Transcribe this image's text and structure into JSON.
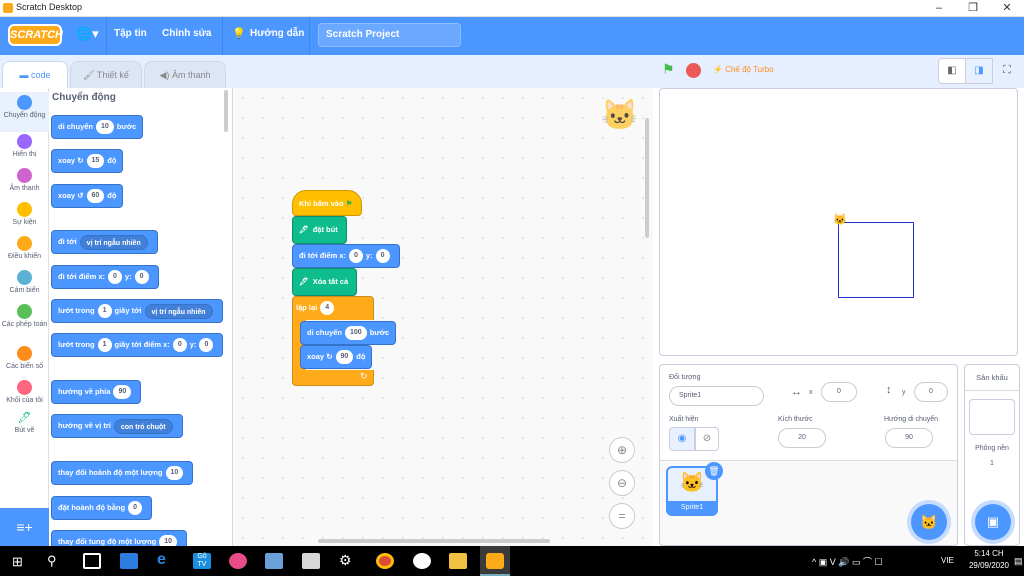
{
  "window": {
    "title": "Scratch Desktop",
    "min": "–",
    "max": "❐",
    "close": "✕"
  },
  "menubar": {
    "logo": "SCRATCH",
    "file": "Tập tin",
    "edit": "Chỉnh sửa",
    "tutorial": "Hướng dẫn",
    "project_title": "Scratch Project"
  },
  "tabs": {
    "code": "code",
    "costumes": "Thiết kế",
    "sounds": "Âm thanh"
  },
  "categories": [
    {
      "label": "Chuyển động",
      "color": "#4c97ff"
    },
    {
      "label": "Hiển thị",
      "color": "#9966ff"
    },
    {
      "label": "Âm thanh",
      "color": "#cf63cf"
    },
    {
      "label": "Sự kiện",
      "color": "#ffbf00"
    },
    {
      "label": "Điều khiển",
      "color": "#ffab19"
    },
    {
      "label": "Cảm biến",
      "color": "#5cb1d6"
    },
    {
      "label": "Các phép toán",
      "color": "#59c059"
    },
    {
      "label": "Các biến số",
      "color": "#ff8c1a"
    },
    {
      "label": "Khối của tôi",
      "color": "#ff6680"
    },
    {
      "label": "Bút vẽ",
      "color": "#0fbd8c"
    }
  ],
  "palette": {
    "heading": "Chuyển động",
    "move": {
      "a": "di chuyển",
      "v": "10",
      "b": "bước"
    },
    "turn_right": {
      "a": "xoay",
      "v": "15",
      "b": "độ"
    },
    "turn_left": {
      "a": "xoay",
      "v": "60",
      "b": "độ"
    },
    "goto": {
      "a": "đi tới",
      "dd": "vị trí ngẫu nhiên"
    },
    "goto_xy": {
      "a": "đi tới điểm x:",
      "x": "0",
      "y_label": "y:",
      "y": "0"
    },
    "glide": {
      "a": "lướt trong",
      "v": "1",
      "b": "giây tới",
      "dd": "vị trí ngẫu nhiên"
    },
    "glide_xy": {
      "a": "lướt trong",
      "v": "1",
      "b": "giây tới điểm x:",
      "x": "0",
      "y_label": "y:",
      "y": "0"
    },
    "point_dir": {
      "a": "hướng về phía",
      "v": "90"
    },
    "point_towards": {
      "a": "hướng về vị trí",
      "dd": "con trỏ chuột"
    },
    "change_x": {
      "a": "thay đổi hoành độ một lượng",
      "v": "10"
    },
    "set_x": {
      "a": "đặt hoành độ bằng",
      "v": "0"
    },
    "change_y": {
      "a": "thay đổi tung độ một lượng",
      "v": "10"
    }
  },
  "script": {
    "hat": "Khi bấm vào",
    "pen_down": "đặt bút",
    "goto": {
      "a": "đi tới điểm x:",
      "x": "0",
      "y_label": "y:",
      "y": "0"
    },
    "clear": "Xóa tất cả",
    "repeat": {
      "a": "lặp lại",
      "v": "4"
    },
    "move": {
      "a": "di chuyển",
      "v": "100",
      "b": "bước"
    },
    "turn": {
      "a": "xoay",
      "v": "90",
      "b": "độ"
    }
  },
  "stage_header": {
    "turbo": "Chế độ Turbo"
  },
  "sprite_info": {
    "sprite_label": "Đối tượng",
    "sprite_name": "Sprite1",
    "x_label": "x",
    "x": "0",
    "y_label": "y",
    "y": "0",
    "show_label": "Xuất hiện",
    "size_label": "Kích thước",
    "size": "20",
    "dir_label": "Hướng di chuyển",
    "direction": "90",
    "thumb_name": "Sprite1"
  },
  "stage_panel": {
    "title": "Sân khấu",
    "backdrops_label": "Phông nền",
    "backdrops": "1"
  },
  "taskbar": {
    "lang": "VIE",
    "time": "5:14 CH",
    "date": "29/09/2020"
  }
}
